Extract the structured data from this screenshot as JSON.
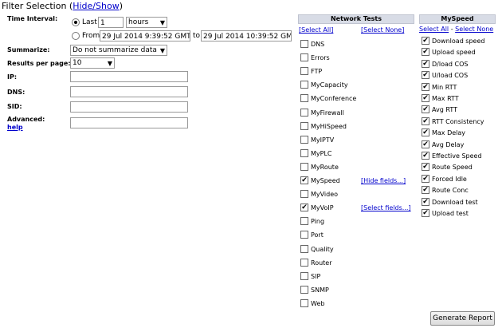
{
  "header": {
    "title": "Filter Selection",
    "toggle": "Hide/Show"
  },
  "form": {
    "time_interval_label": "Time Interval:",
    "last_label": "Last",
    "last_value": "1",
    "unit_value": "hours",
    "from_label": "From",
    "from_value": "29 Jul 2014 9:39:52 GMT-0",
    "to_label": "to",
    "to_value": "29 Jul 2014 10:39:52 GMT",
    "summarize_label": "Summarize:",
    "summarize_value": "Do not summarize data",
    "results_label": "Results per page:",
    "results_value": "10",
    "ip_label": "IP:",
    "dns_label": "DNS:",
    "sid_label": "SID:",
    "advanced_label": "Advanced:",
    "help_label": "help",
    "ip_value": "",
    "dns_value": "",
    "sid_value": "",
    "advanced_value": ""
  },
  "network_tests": {
    "header": "Network Tests",
    "select_all": "[Select All]",
    "select_none": "[Select None]",
    "hide_fields": "[Hide fields...]",
    "select_fields": "[Select fields...]",
    "items": [
      {
        "label": "DNS",
        "checked": false
      },
      {
        "label": "Errors",
        "checked": false
      },
      {
        "label": "FTP",
        "checked": false
      },
      {
        "label": "MyCapacity",
        "checked": false
      },
      {
        "label": "MyConference",
        "checked": false
      },
      {
        "label": "MyFirewall",
        "checked": false
      },
      {
        "label": "MyHiSpeed",
        "checked": false
      },
      {
        "label": "MyIPTV",
        "checked": false
      },
      {
        "label": "MyPLC",
        "checked": false
      },
      {
        "label": "MyRoute",
        "checked": false
      },
      {
        "label": "MySpeed",
        "checked": true
      },
      {
        "label": "MyVideo",
        "checked": false
      },
      {
        "label": "MyVoIP",
        "checked": true
      },
      {
        "label": "Ping",
        "checked": false
      },
      {
        "label": "Port",
        "checked": false
      },
      {
        "label": "Quality",
        "checked": false
      },
      {
        "label": "Router",
        "checked": false
      },
      {
        "label": "SIP",
        "checked": false
      },
      {
        "label": "SNMP",
        "checked": false
      },
      {
        "label": "Web",
        "checked": false
      }
    ]
  },
  "myspeed": {
    "header": "MySpeed",
    "select_all": "Select All",
    "dash": "-",
    "select_none": "Select None",
    "items": [
      {
        "label": "Download speed",
        "checked": true
      },
      {
        "label": "Upload speed",
        "checked": true
      },
      {
        "label": "D/load COS",
        "checked": true
      },
      {
        "label": "U/load COS",
        "checked": true
      },
      {
        "label": "Min RTT",
        "checked": true
      },
      {
        "label": "Max RTT",
        "checked": true
      },
      {
        "label": "Avg RTT",
        "checked": true
      },
      {
        "label": "RTT Consistency",
        "checked": true
      },
      {
        "label": "Max Delay",
        "checked": true
      },
      {
        "label": "Avg Delay",
        "checked": true
      },
      {
        "label": "Effective Speed",
        "checked": true
      },
      {
        "label": "Route Speed",
        "checked": true
      },
      {
        "label": "Forced Idle",
        "checked": true
      },
      {
        "label": "Route Conc",
        "checked": true
      },
      {
        "label": "Download test",
        "checked": true
      },
      {
        "label": "Upload test",
        "checked": true
      }
    ]
  },
  "actions": {
    "generate": "Generate Report"
  }
}
